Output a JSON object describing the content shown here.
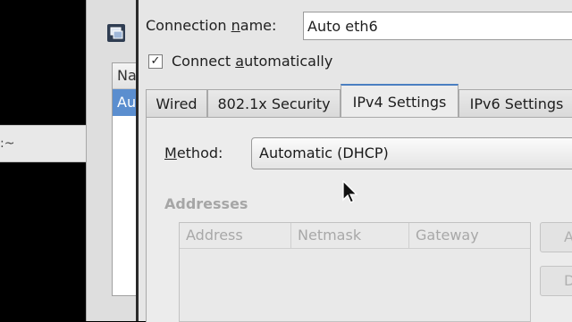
{
  "terminal": {
    "prompt_fragment": ":~"
  },
  "connections_window": {
    "list_header": "Na",
    "selected_row": "Au"
  },
  "dialog": {
    "connection_name_label_pre": "Connection ",
    "connection_name_label_key": "n",
    "connection_name_label_post": "ame:",
    "connection_name_value": "Auto eth6",
    "connect_auto_checked": true,
    "connect_auto_check_glyph": "✓",
    "connect_auto_label_pre": "Connect ",
    "connect_auto_label_key": "a",
    "connect_auto_label_post": "utomatically",
    "tabs": [
      {
        "label": "Wired",
        "active": false
      },
      {
        "label": "802.1x Security",
        "active": false
      },
      {
        "label": "IPv4 Settings",
        "active": true
      },
      {
        "label": "IPv6 Settings",
        "active": false
      }
    ],
    "method_label_key": "M",
    "method_label_post": "ethod:",
    "method_value": "Automatic (DHCP)",
    "addresses_title": "Addresses",
    "addresses_columns": [
      "Address",
      "Netmask",
      "Gateway"
    ],
    "side_buttons": [
      "A",
      "D"
    ]
  },
  "colors": {
    "accent": "#4a7fc1",
    "selection": "#5b8ecf",
    "disabled_text": "#a8a8a8"
  }
}
